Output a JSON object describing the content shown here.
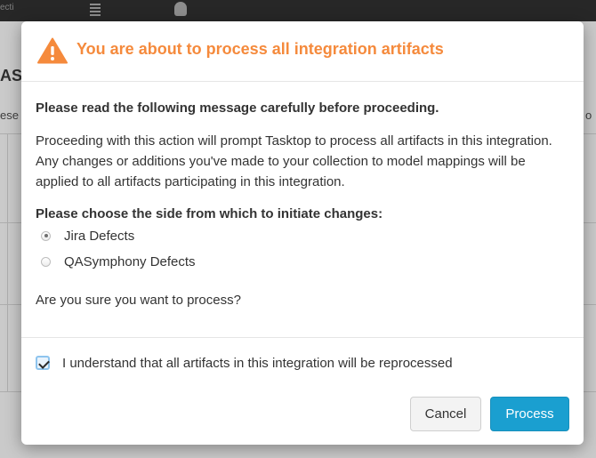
{
  "background": {
    "topbar_text": "ecti",
    "page_heading_fragment": "AS",
    "subtext_left": "ese",
    "subtext_right": "o"
  },
  "modal": {
    "icon": "warning-triangle-icon",
    "title": "You are about to process all integration artifacts",
    "read_heading": "Please read the following message carefully before proceeding.",
    "message": "Proceeding with this action will prompt Tasktop to process all artifacts in this integration. Any changes or additions you've made to your collection to model mappings will be applied to all artifacts participating in this integration.",
    "choose_heading": "Please choose the side from which to initiate changes:",
    "options": [
      {
        "label": "Jira Defects",
        "selected": true
      },
      {
        "label": "QASymphony Defects",
        "selected": false
      }
    ],
    "confirm_question": "Are you sure you want to process?",
    "acknowledge": {
      "label": "I understand that all artifacts in this integration will be reprocessed",
      "checked": true
    },
    "buttons": {
      "cancel": "Cancel",
      "process": "Process"
    }
  },
  "colors": {
    "title_orange": "#f58a3c",
    "primary_button": "#1a9fd0",
    "checkbox_focus": "#8ec4ee"
  }
}
